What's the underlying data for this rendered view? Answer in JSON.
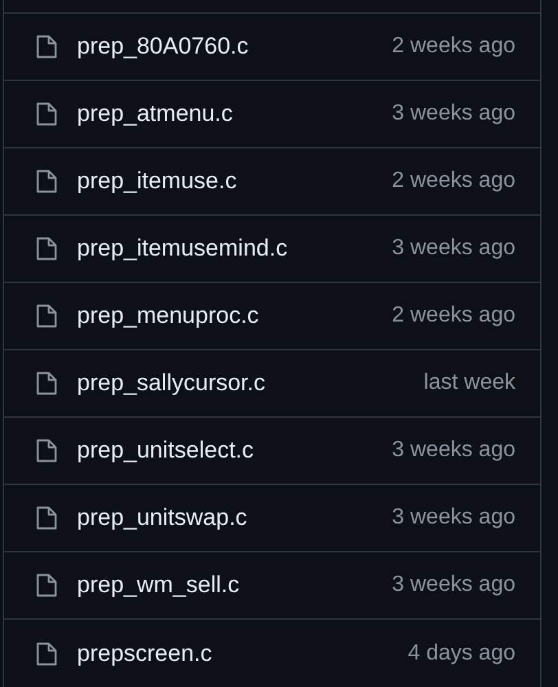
{
  "files": [
    {
      "name": "prep_80A0760.c",
      "time": "2 weeks ago"
    },
    {
      "name": "prep_atmenu.c",
      "time": "3 weeks ago"
    },
    {
      "name": "prep_itemuse.c",
      "time": "2 weeks ago"
    },
    {
      "name": "prep_itemusemind.c",
      "time": "3 weeks ago"
    },
    {
      "name": "prep_menuproc.c",
      "time": "2 weeks ago"
    },
    {
      "name": "prep_sallycursor.c",
      "time": "last week"
    },
    {
      "name": "prep_unitselect.c",
      "time": "3 weeks ago"
    },
    {
      "name": "prep_unitswap.c",
      "time": "3 weeks ago"
    },
    {
      "name": "prep_wm_sell.c",
      "time": "3 weeks ago"
    },
    {
      "name": "prepscreen.c",
      "time": "4 days ago"
    }
  ]
}
